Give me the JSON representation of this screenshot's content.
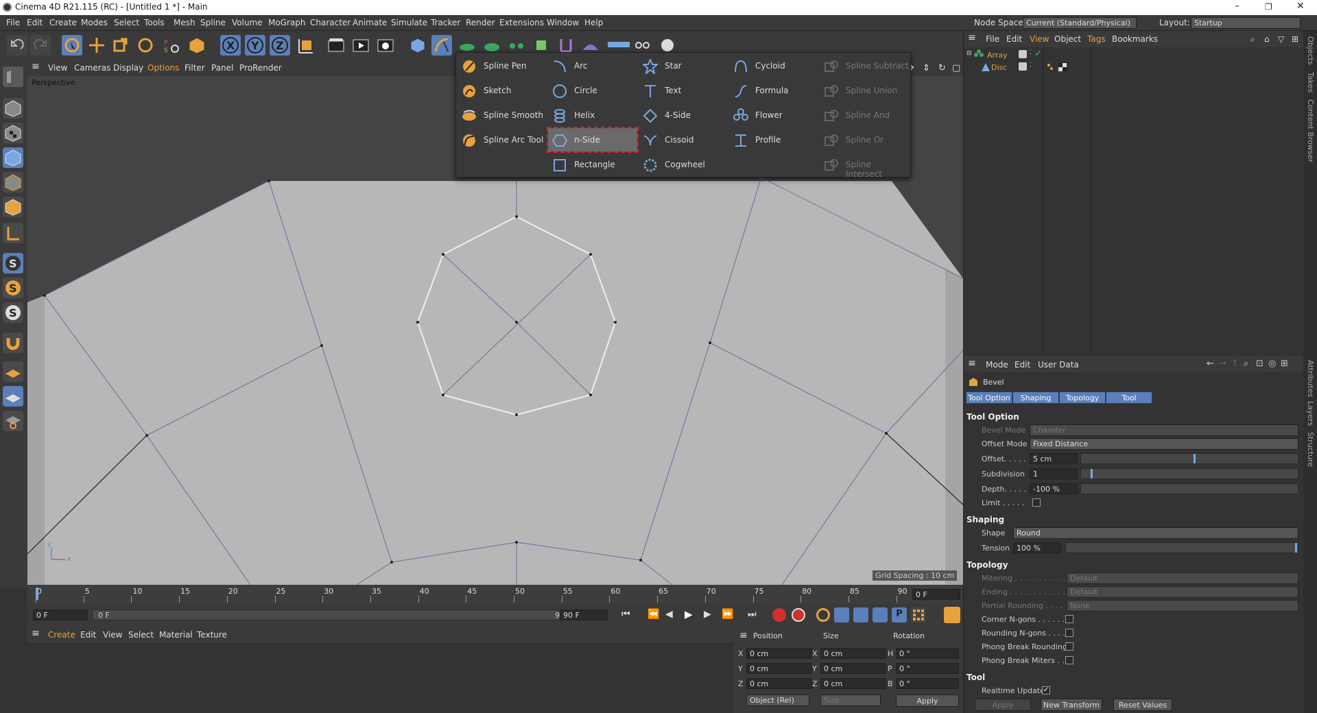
{
  "titlebar": {
    "title": "Cinema 4D R21.115 (RC) - [Untitled 1 *] - Main",
    "minimize": "–",
    "maximize": "❐",
    "close": "✕"
  },
  "menubar": {
    "items": [
      "File",
      "Edit",
      "Create",
      "Modes",
      "Select",
      "Tools",
      "Mesh",
      "Spline",
      "Volume",
      "MoGraph",
      "Character",
      "Animate",
      "Simulate",
      "Tracker",
      "Render",
      "Extensions",
      "Window",
      "Help"
    ],
    "node_space_label": "Node Space:",
    "node_space_value": "Current (Standard/Physical)",
    "layout_label": "Layout:",
    "layout_value": "Startup"
  },
  "toolbar": {
    "axis_x": "X",
    "axis_y": "Y",
    "axis_z": "Z"
  },
  "viewport": {
    "menu": [
      "View",
      "Cameras",
      "Display",
      "Options",
      "Filter",
      "Panel",
      "ProRender"
    ],
    "label": "Perspective",
    "grid_spacing": "Grid Spacing : 10 cm",
    "axis_y": "y",
    "axis_x": "x"
  },
  "timeline": {
    "ticks": [
      "0",
      "5",
      "10",
      "15",
      "20",
      "25",
      "30",
      "35",
      "40",
      "45",
      "50",
      "55",
      "60",
      "65",
      "70",
      "75",
      "80",
      "85",
      "90"
    ],
    "current_frame": "0 F"
  },
  "transport": {
    "start": "0 F",
    "range_start": "0 F",
    "range_end": "90 F",
    "end": "90 F"
  },
  "material": {
    "menu": [
      "Create",
      "Edit",
      "View",
      "Select",
      "Material",
      "Texture"
    ]
  },
  "coords": {
    "headers": [
      "Position",
      "Size",
      "Rotation"
    ],
    "rows": [
      {
        "a": "X",
        "pos": "0 cm",
        "b": "X",
        "size": "0 cm",
        "c": "H",
        "rot": "0 °"
      },
      {
        "a": "Y",
        "pos": "0 cm",
        "b": "Y",
        "size": "0 cm",
        "c": "P",
        "rot": "0 °"
      },
      {
        "a": "Z",
        "pos": "0 cm",
        "b": "Z",
        "size": "0 cm",
        "c": "B",
        "rot": "0 °"
      }
    ],
    "mode": "Object (Rel)",
    "size_mode": "Size",
    "apply": "Apply"
  },
  "objects": {
    "menu": [
      "File",
      "Edit",
      "View",
      "Object",
      "Tags",
      "Bookmarks"
    ],
    "items": [
      {
        "name": "Array"
      },
      {
        "name": "Disc"
      }
    ]
  },
  "attributes": {
    "menu": [
      "Mode",
      "Edit",
      "User Data"
    ],
    "object": "Bevel",
    "tabs": [
      "Tool Option",
      "Shaping",
      "Topology",
      "Tool"
    ],
    "tool_option": {
      "title": "Tool Option",
      "bevel_mode_label": "Bevel Mode",
      "bevel_mode": "Chamfer",
      "offset_mode_label": "Offset Mode",
      "offset_mode": "Fixed Distance",
      "offset_label": "Offset. . . . .",
      "offset": "5 cm",
      "subdivision_label": "Subdivision",
      "subdivision": "1",
      "depth_label": "Depth. . . . .",
      "depth": "-100 %",
      "limit_label": "Limit  . . . . ."
    },
    "shaping": {
      "title": "Shaping",
      "shape_label": "Shape",
      "shape": "Round",
      "tension_label": "Tension",
      "tension": "100 %"
    },
    "topology": {
      "title": "Topology",
      "mitering_label": "Mitering . . . . . . . . . . .",
      "mitering": "Default",
      "ending_label": "Ending . . . . . . . . . . . .",
      "ending": "Default",
      "partial_label": "Partial Rounding . . . .",
      "partial": "None",
      "corner_label": "Corner N-gons . . . . . .",
      "rounding_label": "Rounding N-gons . . . .",
      "phong_round_label": "Phong Break Rounding",
      "phong_miter_label": "Phong Break Miters . ."
    },
    "tool": {
      "title": "Tool",
      "realtime_label": "Realtime Update",
      "apply": "Apply",
      "new_transform": "New Transform",
      "reset": "Reset Values"
    }
  },
  "side_tabs": [
    "Objects",
    "Takes",
    "Content Browser",
    "Attributes",
    "Layers",
    "Structure"
  ],
  "popup": {
    "columns": [
      [
        {
          "label": "Spline Pen",
          "icon": "spline-pen-icon"
        },
        {
          "label": "Sketch",
          "icon": "sketch-icon"
        },
        {
          "label": "Spline Smooth",
          "icon": "spline-smooth-icon"
        },
        {
          "label": "Spline Arc Tool",
          "icon": "spline-arc-tool-icon"
        }
      ],
      [
        {
          "label": "Arc",
          "icon": "arc-icon"
        },
        {
          "label": "Circle",
          "icon": "circle-icon"
        },
        {
          "label": "Helix",
          "icon": "helix-icon"
        },
        {
          "label": "n-Side",
          "icon": "n-side-icon"
        },
        {
          "label": "Rectangle",
          "icon": "rectangle-icon"
        }
      ],
      [
        {
          "label": "Star",
          "icon": "star-icon"
        },
        {
          "label": "Text",
          "icon": "text-icon"
        },
        {
          "label": "4-Side",
          "icon": "four-side-icon"
        },
        {
          "label": "Cissoid",
          "icon": "cissoid-icon"
        },
        {
          "label": "Cogwheel",
          "icon": "cogwheel-icon"
        }
      ],
      [
        {
          "label": "Cycloid",
          "icon": "cycloid-icon"
        },
        {
          "label": "Formula",
          "icon": "formula-icon"
        },
        {
          "label": "Flower",
          "icon": "flower-icon"
        },
        {
          "label": "Profile",
          "icon": "profile-icon"
        }
      ],
      [
        {
          "label": "Spline Subtract",
          "icon": "spline-subtract-icon"
        },
        {
          "label": "Spline Union",
          "icon": "spline-union-icon"
        },
        {
          "label": "Spline And",
          "icon": "spline-and-icon"
        },
        {
          "label": "Spline Or",
          "icon": "spline-or-icon"
        },
        {
          "label": "Spline Intersect",
          "icon": "spline-intersect-icon"
        }
      ]
    ],
    "highlighted": "n-Side"
  },
  "colors": {
    "accent": "#5b7fb9",
    "highlight_outline": "#e02020",
    "icon_orange": "#e6a23c",
    "icon_blue": "#7aa7e0"
  }
}
